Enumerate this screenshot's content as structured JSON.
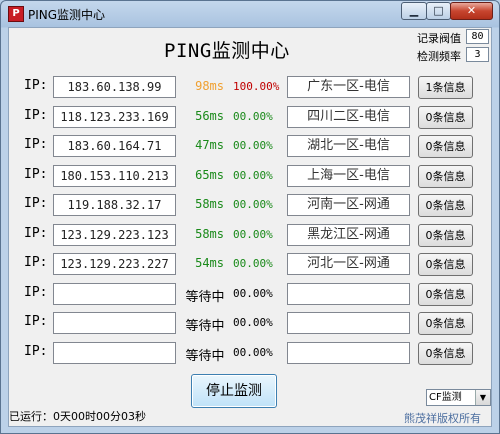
{
  "window": {
    "title": "PING监测中心",
    "min_glyph": "▁",
    "max_glyph": "□",
    "close_glyph": "✕",
    "icon": "red-app-icon"
  },
  "header": {
    "title": "PING监测中心",
    "threshold_label": "记录阀值",
    "threshold_value": "80",
    "frequency_label": "检测频率",
    "frequency_value": "3"
  },
  "ip_label": "IP:",
  "rows": [
    {
      "ip": "183.60.138.99",
      "ms": "98ms",
      "pct": "100.00%",
      "region": "广东一区-电信",
      "info": "1条信息",
      "ms_color": "#f0a030",
      "pct_color": "#c00000"
    },
    {
      "ip": "118.123.233.169",
      "ms": "56ms",
      "pct": "00.00%",
      "region": "四川二区-电信",
      "info": "0条信息",
      "ms_color": "#1a8a1a",
      "pct_color": "#1a8a1a"
    },
    {
      "ip": "183.60.164.71",
      "ms": "47ms",
      "pct": "00.00%",
      "region": "湖北一区-电信",
      "info": "0条信息",
      "ms_color": "#1a8a1a",
      "pct_color": "#1a8a1a"
    },
    {
      "ip": "180.153.110.213",
      "ms": "65ms",
      "pct": "00.00%",
      "region": "上海一区-电信",
      "info": "0条信息",
      "ms_color": "#1a8a1a",
      "pct_color": "#1a8a1a"
    },
    {
      "ip": "119.188.32.17",
      "ms": "58ms",
      "pct": "00.00%",
      "region": "河南一区-网通",
      "info": "0条信息",
      "ms_color": "#1a8a1a",
      "pct_color": "#1a8a1a"
    },
    {
      "ip": "123.129.223.123",
      "ms": "58ms",
      "pct": "00.00%",
      "region": "黑龙江区-网通",
      "info": "0条信息",
      "ms_color": "#1a8a1a",
      "pct_color": "#1a8a1a"
    },
    {
      "ip": "123.129.223.227",
      "ms": "54ms",
      "pct": "00.00%",
      "region": "河北一区-网通",
      "info": "0条信息",
      "ms_color": "#1a8a1a",
      "pct_color": "#1a8a1a"
    },
    {
      "ip": "",
      "waiting": "等待中",
      "pct": "00.00%",
      "region": "",
      "info": "0条信息",
      "pct_color": "#000000"
    },
    {
      "ip": "",
      "waiting": "等待中",
      "pct": "00.00%",
      "region": "",
      "info": "0条信息",
      "pct_color": "#000000"
    },
    {
      "ip": "",
      "waiting": "等待中",
      "pct": "00.00%",
      "region": "",
      "info": "0条信息",
      "pct_color": "#000000"
    }
  ],
  "controls": {
    "stop_label": "停止监测",
    "dns_selected": "CF监测",
    "dns_arrow": "▼"
  },
  "footer": {
    "status": "已运行：0天00时00分03秒",
    "copyright": "熊茂祥版权所有"
  }
}
